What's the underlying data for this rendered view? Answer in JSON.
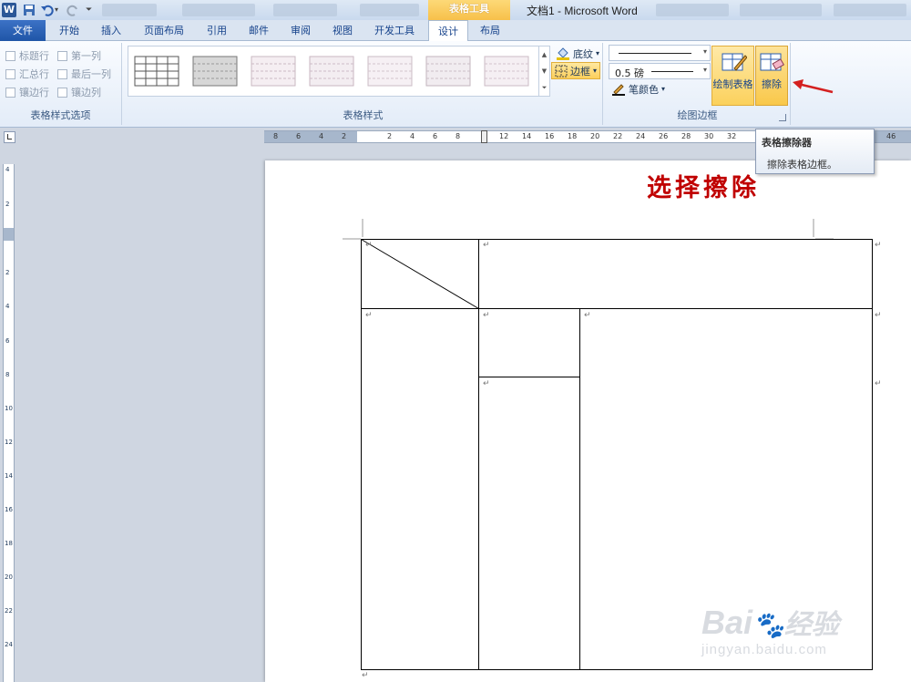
{
  "app": {
    "icon_letter": "W",
    "window_title": "文档1 - Microsoft Word",
    "context_tab": "表格工具"
  },
  "tabs": [
    "文件",
    "开始",
    "插入",
    "页面布局",
    "引用",
    "邮件",
    "审阅",
    "视图",
    "开发工具",
    "设计",
    "布局"
  ],
  "table_style_options": {
    "group_label": "表格样式选项",
    "items": [
      {
        "label": "标题行",
        "checked": false
      },
      {
        "label": "第一列",
        "checked": false
      },
      {
        "label": "汇总行",
        "checked": false
      },
      {
        "label": "最后一列",
        "checked": false
      },
      {
        "label": "镶边行",
        "checked": false
      },
      {
        "label": "镶边列",
        "checked": false
      }
    ]
  },
  "table_styles": {
    "group_label": "表格样式",
    "shading_label": "底纹",
    "borders_label": "边框"
  },
  "draw_borders": {
    "group_label": "绘图边框",
    "line_weight": "0.5 磅",
    "pen_color_label": "笔颜色",
    "draw_table_label": "绘制表格",
    "eraser_label": "擦除"
  },
  "tooltip": {
    "title": "表格擦除器",
    "body": "擦除表格边框。"
  },
  "ruler_top": [
    "8",
    "6",
    "4",
    "2",
    "2",
    "4",
    "6",
    "8",
    "12",
    "14",
    "16",
    "18",
    "20",
    "22",
    "24",
    "26",
    "28",
    "30",
    "32",
    "46"
  ],
  "ruler_left": [
    "4",
    "2",
    "2",
    "4",
    "6",
    "8",
    "10",
    "12",
    "14",
    "16",
    "18",
    "20",
    "22",
    "24"
  ],
  "document": {
    "heading": "选择擦除",
    "paragraph_mark": "↵"
  },
  "watermark": {
    "brand": "Bai",
    "brand2": "经验",
    "url": "jingyan.baidu.com"
  },
  "colors": {
    "file_tab": "#2a5db0",
    "context_tab": "#f7c04a",
    "heading": "#c00000",
    "arrow": "#d42020"
  }
}
